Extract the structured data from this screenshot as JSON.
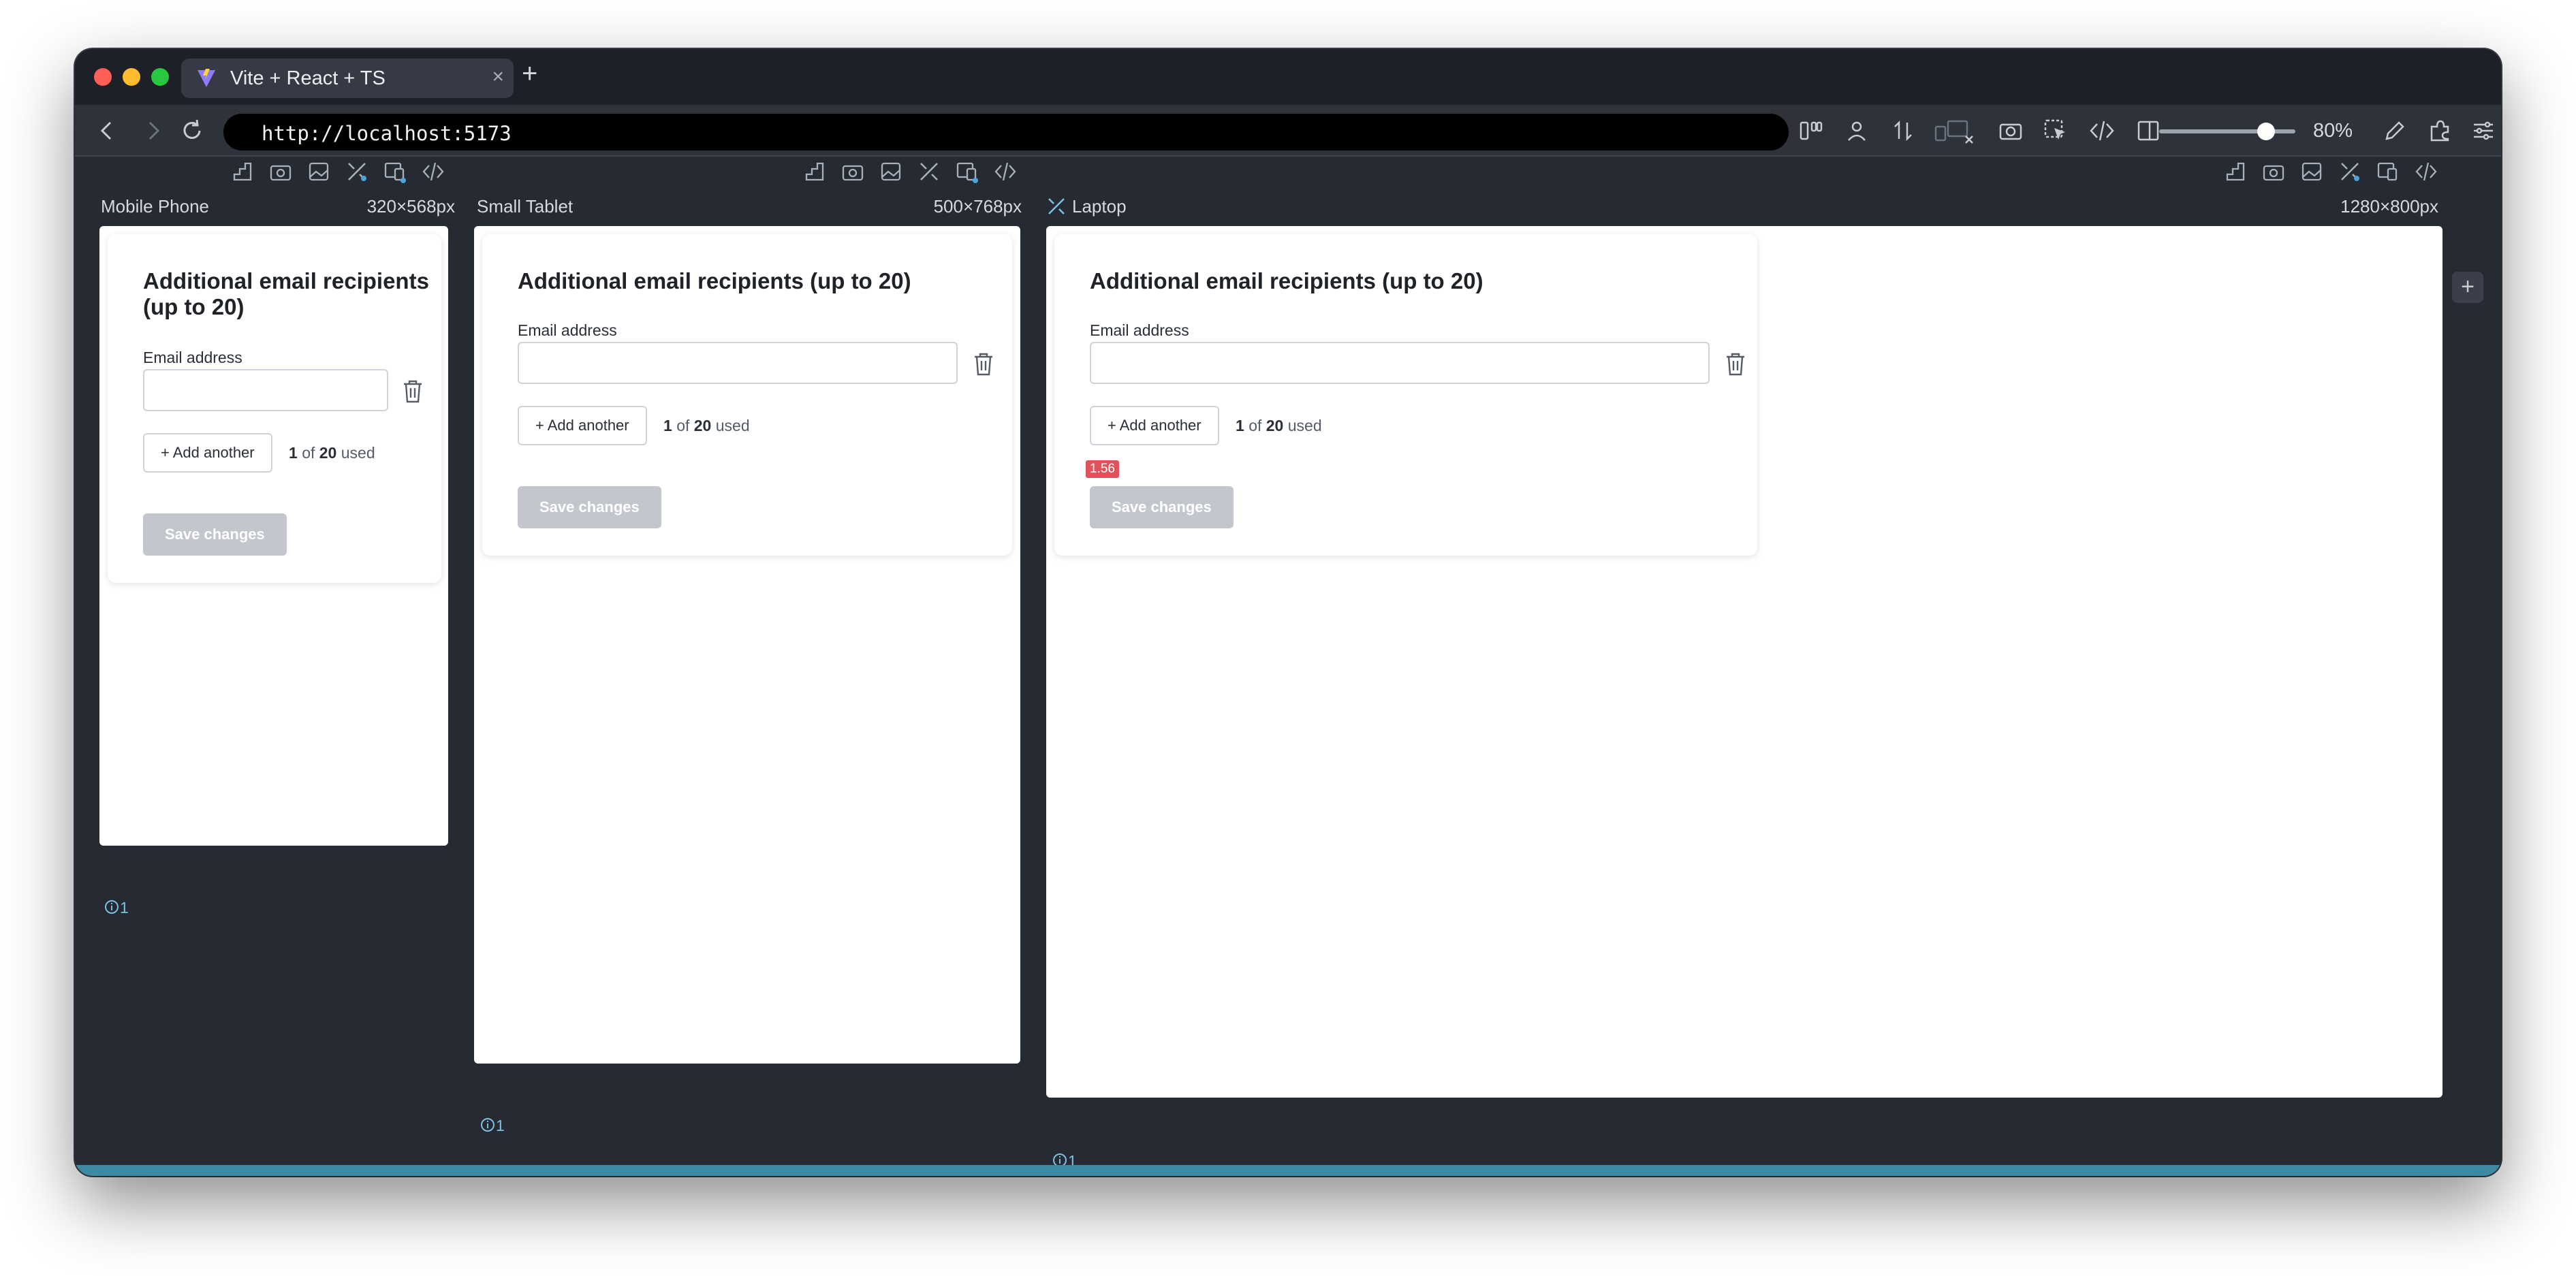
{
  "browser": {
    "tab_title": "Vite + React + TS",
    "tab_close": "×",
    "new_tab": "+",
    "url": "http://localhost:5173",
    "zoom_value": "80%",
    "zoom_level": 0.8
  },
  "devices": [
    {
      "label": "Mobile Phone",
      "size": "320×568px",
      "info": "1"
    },
    {
      "label": "Small Tablet",
      "size": "500×768px",
      "info": "1"
    },
    {
      "label": "Laptop",
      "size": "1280×800px",
      "info": "1"
    }
  ],
  "form": {
    "title": "Additional email recipients (up to 20)",
    "field_label": "Email address",
    "email_value": "",
    "add_button": "+ Add another",
    "usage_count": "1",
    "usage_of": "of",
    "usage_max": "20",
    "usage_suffix": "used",
    "save_button": "Save changes"
  },
  "badge": "1.56",
  "side_add": "+",
  "colors": {
    "window_bg": "#262a33",
    "badge": "#e0525c",
    "save_disabled": "#c3c7cd",
    "info": "#7cc0dd"
  },
  "icons": {
    "device_toolbar": [
      "ruler-icon",
      "camera-icon",
      "image-icon",
      "tools-icon",
      "device-sync-icon",
      "code-icon"
    ],
    "browser_toolbar": [
      "layout-icon",
      "user-icon",
      "arrows-icon",
      "devices-off-icon",
      "camera-icon",
      "cursor-icon",
      "code-icon",
      "sidebar-icon",
      "pen-icon",
      "extension-icon",
      "settings-icon"
    ]
  }
}
